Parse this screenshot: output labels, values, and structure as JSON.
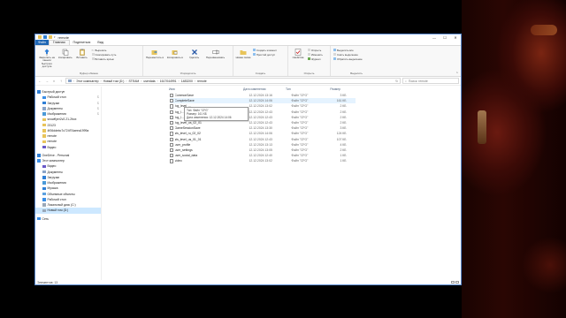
{
  "window": {
    "title": "remote",
    "controls": {
      "minimize": "—",
      "maximize": "☐",
      "close": "✕"
    }
  },
  "ribbon_tabs": [
    "Файл",
    "Главная",
    "Поделиться",
    "Вид"
  ],
  "ribbon": {
    "clipboard": {
      "pin_label": "Закрепить на панели быстрого доступа",
      "copy_label": "Копировать",
      "paste_label": "Вставить",
      "cut": "Вырезать",
      "copy_path": "Скопировать путь",
      "paste_shortcut": "Вставить ярлык",
      "group": "Буфер обмена"
    },
    "organize": {
      "move": "Переместить в",
      "copy": "Копировать в",
      "delete": "Удалить",
      "rename": "Переименовать",
      "group": "Упорядочить"
    },
    "create": {
      "new_folder": "Новая папка",
      "new_item": "Создать элемент",
      "easy_access": "Простой доступ",
      "group": "Создать"
    },
    "open": {
      "properties": "Свойства",
      "open": "Открыть",
      "edit": "Изменить",
      "history": "Журнал",
      "group": "Открыть"
    },
    "select": {
      "select_all": "Выделить все",
      "select_none": "Снять выделение",
      "invert": "Обратить выделение",
      "group": "Выделить"
    }
  },
  "address": {
    "path": [
      "Этот компьютер",
      "Новый том (D:)",
      "STEAM",
      "userdata",
      "1617044991",
      "1483200",
      "remote"
    ],
    "search_placeholder": "Поиск: remote"
  },
  "columns": {
    "name": "Имя",
    "date": "Дата изменения",
    "type": "Тип",
    "size": "Размер"
  },
  "files": [
    {
      "name": "CommonSave",
      "date": "12.12.2024 13:16",
      "type": "Файл \"CFG\"",
      "size": "3 КБ"
    },
    {
      "name": "CompleteSave",
      "date": "12.12.2024 14:06",
      "type": "Файл \"CFG\"",
      "size": "161 КБ"
    },
    {
      "name": "fog_level_...",
      "date": "12.12.2024 13:02",
      "type": "Файл \"CFG\"",
      "size": "2 КБ"
    },
    {
      "name": "fog_l...",
      "date": "12.12.2024 12:43",
      "type": "Файл \"CFG\"",
      "size": "2 КБ"
    },
    {
      "name": "fog_l...",
      "date": "12.12.2024 12:43",
      "type": "Файл \"CFG\"",
      "size": "2 КБ"
    },
    {
      "name": "fog_level_us_02_01",
      "date": "12.12.2024 12:43",
      "type": "Файл \"CFG\"",
      "size": "2 КБ"
    },
    {
      "name": "GameSessionSave",
      "date": "12.12.2024 13:30",
      "type": "Файл \"CFG\"",
      "size": "3 КБ"
    },
    {
      "name": "sts_level_ru_02_02",
      "date": "12.12.2024 14:06",
      "type": "Файл \"CFG\"",
      "size": "124 КБ"
    },
    {
      "name": "sts_level_us_01_01",
      "date": "12.12.2024 12:43",
      "type": "Файл \"CFG\"",
      "size": "107 КБ"
    },
    {
      "name": "user_profile",
      "date": "12.12.2024 13:13",
      "type": "Файл \"CFG\"",
      "size": "4 КБ"
    },
    {
      "name": "user_settings",
      "date": "12.12.2024 13:05",
      "type": "Файл \"CFG\"",
      "size": "2 КБ"
    },
    {
      "name": "user_social_data",
      "date": "12.12.2024 12:40",
      "type": "Файл \"CFG\"",
      "size": "1 КБ"
    },
    {
      "name": "video",
      "date": "12.12.2024 13:02",
      "type": "Файл \"CFG\"",
      "size": "1 КБ"
    }
  ],
  "tooltip": {
    "type": "Тип: Файл \"CFG\"",
    "size": "Размер: 161 КБ",
    "modified": "Дата изменения: 12.12.2024 14:06"
  },
  "nav": [
    {
      "label": "Быстрый доступ",
      "icon": "star-icon",
      "color": "#2f7fd6",
      "indent": 2,
      "pin": false
    },
    {
      "label": "Рабочий стол",
      "icon": "desktop-icon",
      "color": "#3a8ee6",
      "indent": 8,
      "pin": true
    },
    {
      "label": "Загрузки",
      "icon": "download-icon",
      "color": "#2f7fd6",
      "indent": 8,
      "pin": true
    },
    {
      "label": "Документы",
      "icon": "documents-icon",
      "color": "#8aa4c8",
      "indent": 8,
      "pin": true
    },
    {
      "label": "Изображения",
      "icon": "pictures-icon",
      "color": "#4a9ad8",
      "indent": 8,
      "pin": true
    },
    {
      "label": "snowflyer2v2.21-2box",
      "icon": "folder-icon",
      "color": "#e8c45a",
      "indent": 8,
      "pin": false
    },
    {
      "label": "23123",
      "icon": "folder-icon",
      "color": "#e8c45a",
      "indent": 8,
      "pin": false
    },
    {
      "label": "4f06ddebc7c724f74aeea1999a",
      "icon": "folder-icon",
      "color": "#e8c45a",
      "indent": 8,
      "pin": false
    },
    {
      "label": "remote",
      "icon": "folder-icon",
      "color": "#e8c45a",
      "indent": 8,
      "pin": false
    },
    {
      "label": "remote",
      "icon": "folder-icon",
      "color": "#e8c45a",
      "indent": 8,
      "pin": false
    },
    {
      "label": "Видео",
      "icon": "video-icon",
      "color": "#6a5ac8",
      "indent": 8,
      "pin": false
    },
    {
      "label": "OneDrive - Personal",
      "icon": "cloud-icon",
      "color": "#2f7fd6",
      "indent": 2,
      "pin": false,
      "gap": true
    },
    {
      "label": "Этот компьютер",
      "icon": "computer-icon",
      "color": "#3a8ee6",
      "indent": 2,
      "pin": false
    },
    {
      "label": "Видео",
      "icon": "video-icon",
      "color": "#6a5ac8",
      "indent": 8,
      "pin": false
    },
    {
      "label": "Документы",
      "icon": "documents-icon",
      "color": "#8aa4c8",
      "indent": 8,
      "pin": false
    },
    {
      "label": "Загрузки",
      "icon": "download-icon",
      "color": "#2f7fd6",
      "indent": 8,
      "pin": false
    },
    {
      "label": "Изображения",
      "icon": "pictures-icon",
      "color": "#4a9ad8",
      "indent": 8,
      "pin": false
    },
    {
      "label": "Музыка",
      "icon": "music-icon",
      "color": "#2f7fd6",
      "indent": 8,
      "pin": false
    },
    {
      "label": "Объемные объекты",
      "icon": "3d-objects-icon",
      "color": "#5aa0e0",
      "indent": 8,
      "pin": false
    },
    {
      "label": "Рабочий стол",
      "icon": "desktop-icon",
      "color": "#3a8ee6",
      "indent": 8,
      "pin": false
    },
    {
      "label": "Локальный диск (C:)",
      "icon": "drive-icon",
      "color": "#9aa8b8",
      "indent": 8,
      "pin": false
    },
    {
      "label": "Новый том (D:)",
      "icon": "drive-icon",
      "color": "#9aa8b8",
      "indent": 8,
      "pin": false,
      "selected": true
    },
    {
      "label": "Сеть",
      "icon": "network-icon",
      "color": "#3a8ee6",
      "indent": 2,
      "pin": false,
      "gap": true
    }
  ],
  "status": {
    "count": "Элементов: 13"
  }
}
